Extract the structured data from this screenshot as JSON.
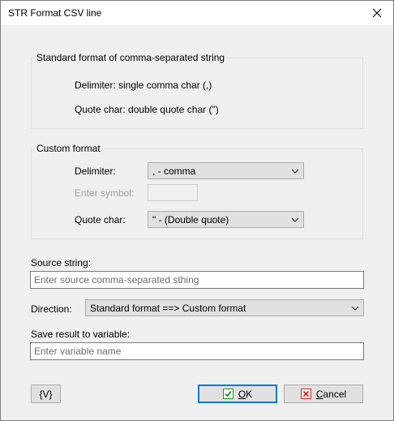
{
  "window": {
    "title": "STR Format CSV line"
  },
  "standard_group": {
    "label": "Standard format of comma-separated string",
    "delimiter_text": "Delimiter: single comma char (,)",
    "quote_text": "Quote char:  double quote char (\")"
  },
  "custom_group": {
    "label": "Custom format",
    "delimiter_label": "Delimiter:",
    "delimiter_value": ", - comma",
    "symbol_label": "Enter symbol:",
    "symbol_value": "",
    "quote_label": "Quote char:",
    "quote_value": "\"  - (Double quote)"
  },
  "source": {
    "label": "Source string:",
    "placeholder": "Enter source comma-separated sthing",
    "value": ""
  },
  "direction": {
    "label": "Direction:",
    "value": "Standard format  ==>  Custom format"
  },
  "result": {
    "label": "Save result to variable:",
    "placeholder": "Enter variable name",
    "value": ""
  },
  "buttons": {
    "vars_label": "{V}",
    "ok_label": "OK",
    "cancel_label": "Cancel"
  },
  "colors": {
    "ok_check": "#1a9c1a",
    "cancel_x": "#d42020",
    "default_border": "#0078d7"
  },
  "icons": {
    "close": "close-icon",
    "ok": "check-icon",
    "cancel": "x-icon",
    "dropdown": "chevron-down-icon"
  }
}
